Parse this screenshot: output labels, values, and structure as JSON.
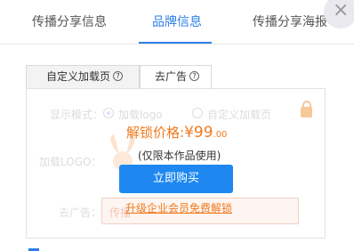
{
  "tabs": {
    "items": [
      "传播分享信息",
      "品牌信息",
      "传播分享海报"
    ],
    "active_index": 1
  },
  "close": {
    "glyph": "×"
  },
  "subtabs": {
    "items": [
      "自定义加载页",
      "去广告"
    ],
    "help_glyph": "?"
  },
  "form_bg": {
    "display_mode_label": "显示模式：",
    "option_logo": "加载logo",
    "option_custom": "自定义加载页",
    "logo_label": "加载LOGO：",
    "ad_label": "去广告：",
    "ad_input_text": "传播"
  },
  "paywall": {
    "price_label": "解锁价格:",
    "price_main": "¥99",
    "price_decimal": ".00",
    "note": "(仅限本作品使用)",
    "buy_button": "立即购买",
    "upgrade_link": "升级企业会员免费解锁"
  },
  "colors": {
    "accent": "#2f7fe6",
    "price": "#f07a1e",
    "button": "#1e88f0"
  }
}
